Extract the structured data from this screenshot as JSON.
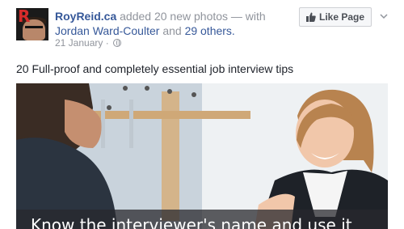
{
  "post": {
    "author": "RoyReid.ca",
    "action": "added 20 new photos",
    "with_sep": "— with",
    "tagged_person": "Jordan Ward-Coulter",
    "and_text": "and",
    "others": "29 others.",
    "date": "21 January",
    "date_sep": "·",
    "privacy_icon": "globe-icon",
    "text": "20 Full-proof and completely essential job interview tips"
  },
  "page_action": {
    "like_label": "Like Page",
    "like_icon": "thumbs-up-icon"
  },
  "photo": {
    "caption": "Know the interviewer's name and use it"
  },
  "colors": {
    "link": "#365899",
    "muted": "#90949c",
    "text": "#1d2129"
  }
}
